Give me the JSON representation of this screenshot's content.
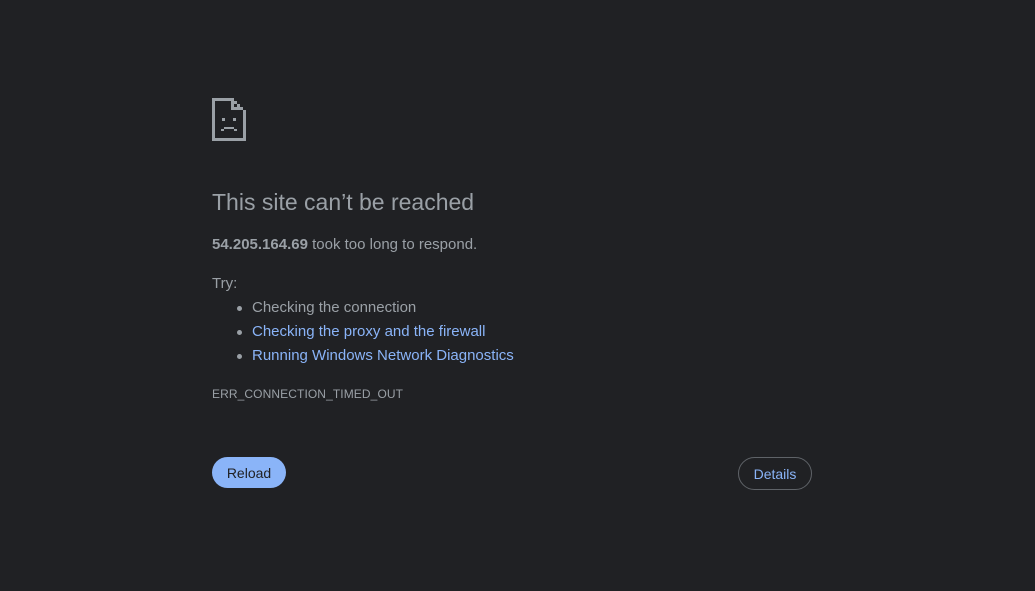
{
  "error": {
    "title": "This site can’t be reached",
    "host": "54.205.164.69",
    "summary_suffix": " took too long to respond.",
    "try_label": "Try:",
    "suggestions": [
      {
        "label": "Checking the connection",
        "is_link": false
      },
      {
        "label": "Checking the proxy and the firewall",
        "is_link": true
      },
      {
        "label": "Running Windows Network Diagnostics",
        "is_link": true
      }
    ],
    "code": "ERR_CONNECTION_TIMED_OUT"
  },
  "buttons": {
    "reload_label": "Reload",
    "details_label": "Details"
  },
  "icons": {
    "error_page": "sad-document-icon"
  },
  "colors": {
    "background": "#202124",
    "text": "#9aa0a6",
    "link": "#8ab4f8",
    "primary_button": "#8ab4f8",
    "outline_border": "#5f6368"
  }
}
